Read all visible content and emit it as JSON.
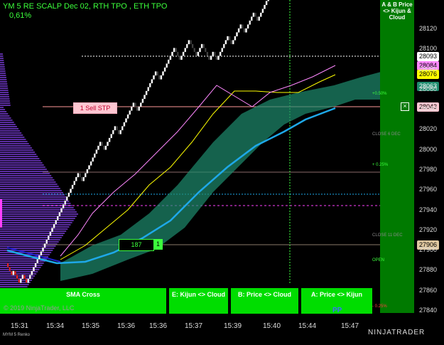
{
  "header": {
    "title": "YM 5 RE SCALP Dec 02, RTH TPO , ETH TPO",
    "change_pct": "0,61%"
  },
  "copyright": "© 2019 NinjaTrader, LLC",
  "footer_left": "MYM 5 Renko",
  "logo": "NINJATRADER",
  "panel": {
    "label": "A & B Price <> Kijun & Cloud"
  },
  "buttons": [
    {
      "label": "SMA  Cross"
    },
    {
      "label": "E: Kijun <> Cloud"
    },
    {
      "label": "B: Price <> Cloud"
    },
    {
      "label": "A: Price <> Kijun"
    }
  ],
  "pp_label": "PP",
  "sell_order": {
    "label": "1 Sell STP",
    "price": "28043"
  },
  "counter": {
    "value": "187",
    "box": "1"
  },
  "levels": [
    {
      "label": "+0.50%",
      "style": "green"
    },
    {
      "label": "CLOSE 6 DEC",
      "style": "grey"
    },
    {
      "label": "+ 0.25%",
      "style": "green"
    },
    {
      "label": "CLOSE 11 DEC",
      "style": "grey"
    },
    {
      "label": "OPEN",
      "style": "green"
    },
    {
      "label": "- 0.25%",
      "style": "red"
    }
  ],
  "price_pills": [
    {
      "label": "28093",
      "color": "#ffffff"
    },
    {
      "label": "28084",
      "color": "#ff88ff"
    },
    {
      "label": "28076",
      "color": "#ffff00"
    },
    {
      "label": "28063",
      "color": "#1e8c6e"
    },
    {
      "label": "28043",
      "color": "#ffc7d2"
    },
    {
      "label": "27906",
      "color": "#e0c8a0"
    }
  ],
  "chart_data": {
    "type": "line",
    "y_ticks": [
      "28120",
      "28100",
      "28080",
      "28060",
      "28040",
      "28020",
      "28000",
      "27980",
      "27960",
      "27940",
      "27920",
      "27900",
      "27880",
      "27860",
      "27840"
    ],
    "x_ticks": [
      "15:31",
      "15:34",
      "15:35",
      "15:36",
      "15:36",
      "15:37",
      "15:39",
      "15:40",
      "15:44",
      "15:47"
    ],
    "ylim": [
      27840,
      28120
    ],
    "colors": {
      "up_brick": "#ffffff",
      "down_brick": "#ff2020",
      "cloud": "#1e8c6e",
      "sma_fast": "#ff88ff",
      "sma_slow": "#ffff00",
      "kijun": "#1ea8e8",
      "panel": "#007a00",
      "volume_profile": "#7a3cd8"
    }
  }
}
